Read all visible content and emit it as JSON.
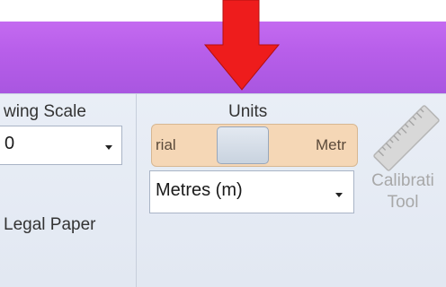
{
  "ribbon": {
    "drawing_scale": {
      "label": "wing Scale",
      "value": "0"
    },
    "paper": {
      "label": "Legal Paper"
    },
    "units": {
      "label": "Units",
      "toggle_left": "rial",
      "toggle_right": "Metr",
      "select_value": "Metres (m)"
    },
    "calibration": {
      "line1": "Calibrati",
      "line2": "Tool"
    }
  },
  "colors": {
    "title_band": "#b85fea",
    "arrow": "#ee1c1c",
    "toggle_bg": "#f5d7b6"
  },
  "icons": {
    "annotation": "red-down-arrow-icon",
    "calibration": "ruler-icon"
  }
}
